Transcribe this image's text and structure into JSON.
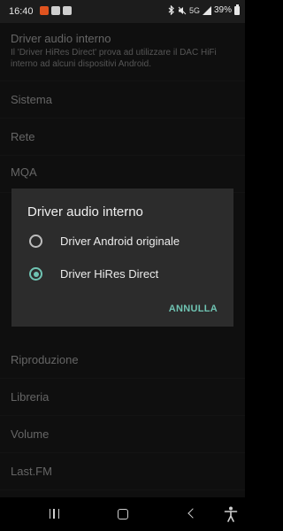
{
  "status_bar": {
    "time": "16:40",
    "notification_icons": [
      "app-notification-icon",
      "app-notification-icon",
      "image-notification-icon"
    ],
    "system_icons": [
      "bluetooth-icon",
      "mute-icon",
      "5g-icon",
      "signal-icon"
    ],
    "network_label": "5G",
    "battery_percent": "39%"
  },
  "settings": {
    "items": [
      {
        "title": "Driver audio interno",
        "description": "Il 'Driver HiRes Direct' prova ad utilizzare il DAC HiFi interno ad alcuni dispositivi Android."
      },
      {
        "title": "Sistema"
      },
      {
        "title": "Rete"
      },
      {
        "title": "MQA"
      },
      {
        "title": "Riproduzione"
      },
      {
        "title": "Libreria"
      },
      {
        "title": "Volume"
      },
      {
        "title": "Last.FM"
      }
    ]
  },
  "dialog": {
    "title": "Driver audio interno",
    "options": [
      {
        "label": "Driver Android originale",
        "selected": false
      },
      {
        "label": "Driver HiRes Direct",
        "selected": true
      }
    ],
    "cancel_label": "ANNULLA"
  },
  "nav_bar": {
    "buttons": [
      "recents-icon",
      "home-icon",
      "back-icon",
      "accessibility-icon"
    ]
  },
  "colors": {
    "accent": "#6fc3b2",
    "background": "#171717",
    "dialog_background": "#2c2c2c"
  }
}
